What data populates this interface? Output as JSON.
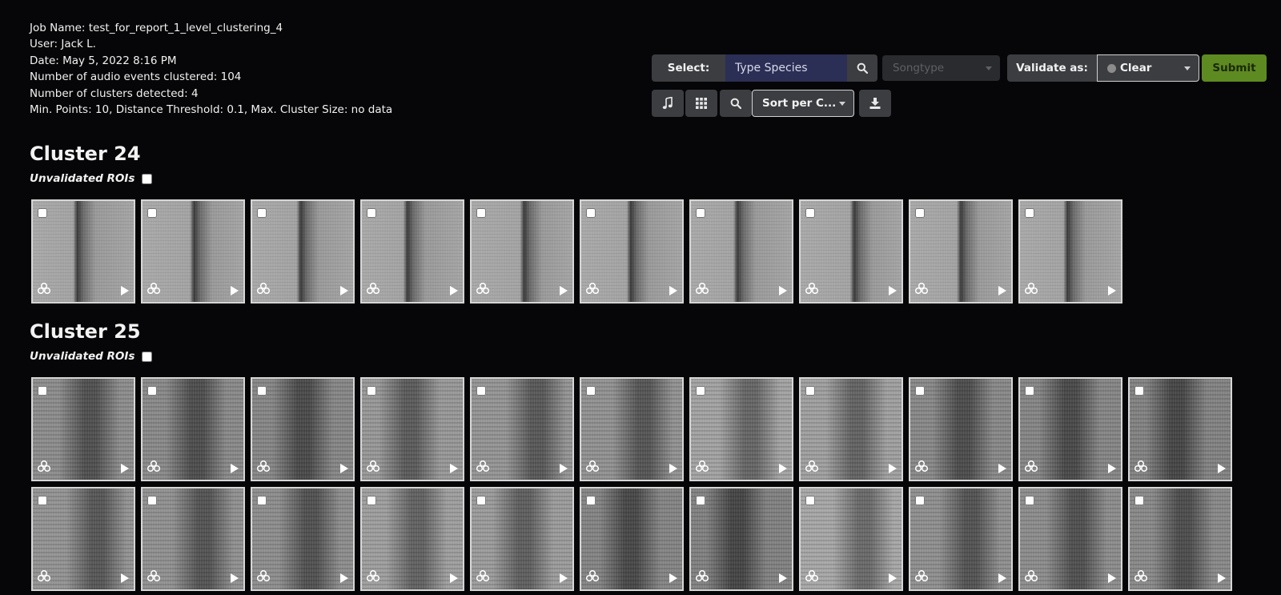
{
  "job": {
    "name": "Job Name: test_for_report_1_level_clustering_4",
    "user": "User: Jack L.",
    "date": "Date: May 5, 2022 8:16 PM",
    "events": "Number of audio events clustered: 104",
    "clusters": "Number of clusters detected: 4",
    "params": "Min. Points: 10, Distance Threshold: 0.1, Max. Cluster Size: no data"
  },
  "toolbar": {
    "select_label": "Select:",
    "species_placeholder": "Type Species",
    "songtype": "Songtype",
    "validate_label": "Validate as:",
    "validate_value": "Clear",
    "submit": "Submit",
    "sort": "Sort per C...",
    "icons": [
      "music-note-icon",
      "grid-icon",
      "search-icon",
      "download-icon"
    ]
  },
  "clusters": [
    {
      "title": "Cluster 24",
      "roi_label": "Unvalidated ROIs",
      "count": 10
    },
    {
      "title": "Cluster 25",
      "roi_label": "Unvalidated ROIs",
      "count": 22
    }
  ],
  "colors": {
    "background": "#060608",
    "panel": "#3b3d41",
    "species_input": "#2b2f55",
    "submit": "#5e8a22",
    "clear_dot": "#8c8c8c"
  }
}
